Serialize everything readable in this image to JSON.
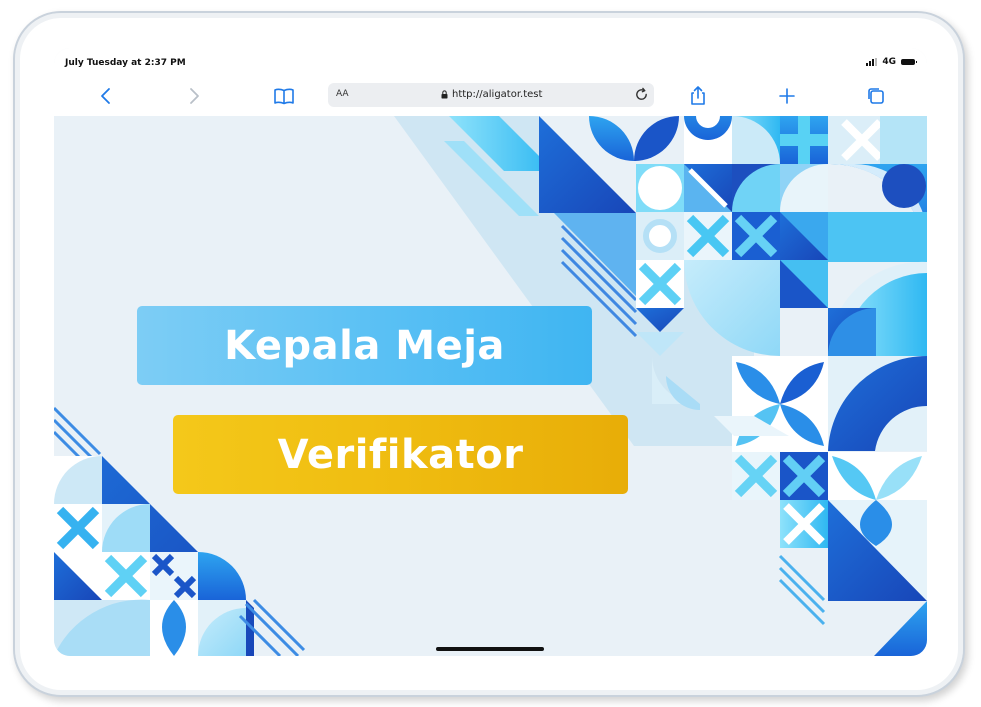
{
  "status_bar": {
    "time": "July Tuesday at 2:37 PM",
    "network": "4G"
  },
  "browser": {
    "text_size_label": "AA",
    "url": "http://aligator.test",
    "icons": {
      "back": "chevron-left-icon",
      "forward": "chevron-right-icon",
      "bookmarks": "book-icon",
      "share": "share-icon",
      "new_tab": "plus-icon",
      "tabs": "tabs-icon",
      "reload": "reload-icon",
      "lock": "lock-icon"
    }
  },
  "menu": {
    "kepala_label": "Kepala Meja",
    "verifikator_label": "Verifikator"
  },
  "colors": {
    "accent": "#1f7ae8",
    "kepala_button": "#5cc1f4",
    "verifikator_button": "#efbc10",
    "background": "#e9f1f7"
  }
}
